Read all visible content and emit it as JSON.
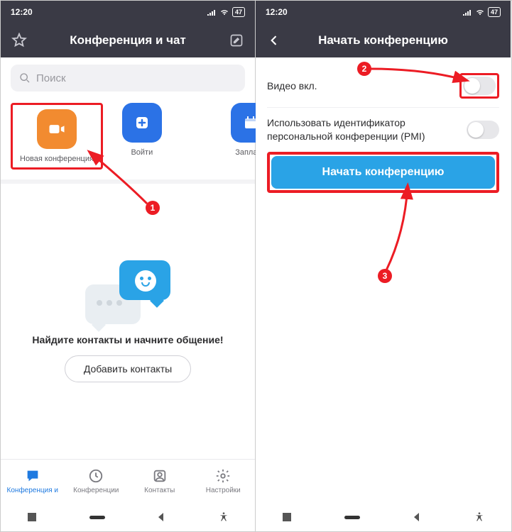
{
  "status": {
    "time": "12:20",
    "battery": "47"
  },
  "left": {
    "title": "Конференция и чат",
    "search_placeholder": "Поиск",
    "actions": {
      "new": "Новая конференция",
      "join": "Войти",
      "schedule": "Заплани"
    },
    "empty_message": "Найдите контакты и начните общение!",
    "add_contacts": "Добавить контакты",
    "tabs": {
      "meet_chat": "Конференция и",
      "meetings": "Конференции",
      "contacts": "Контакты",
      "settings": "Настройки"
    }
  },
  "right": {
    "title": "Начать конференцию",
    "video_on": "Видео вкл.",
    "use_pmi": "Использовать идентификатор персональной конференции (PMI)",
    "start_button": "Начать конференцию"
  },
  "annotations": {
    "step1": "1",
    "step2": "2",
    "step3": "3"
  }
}
